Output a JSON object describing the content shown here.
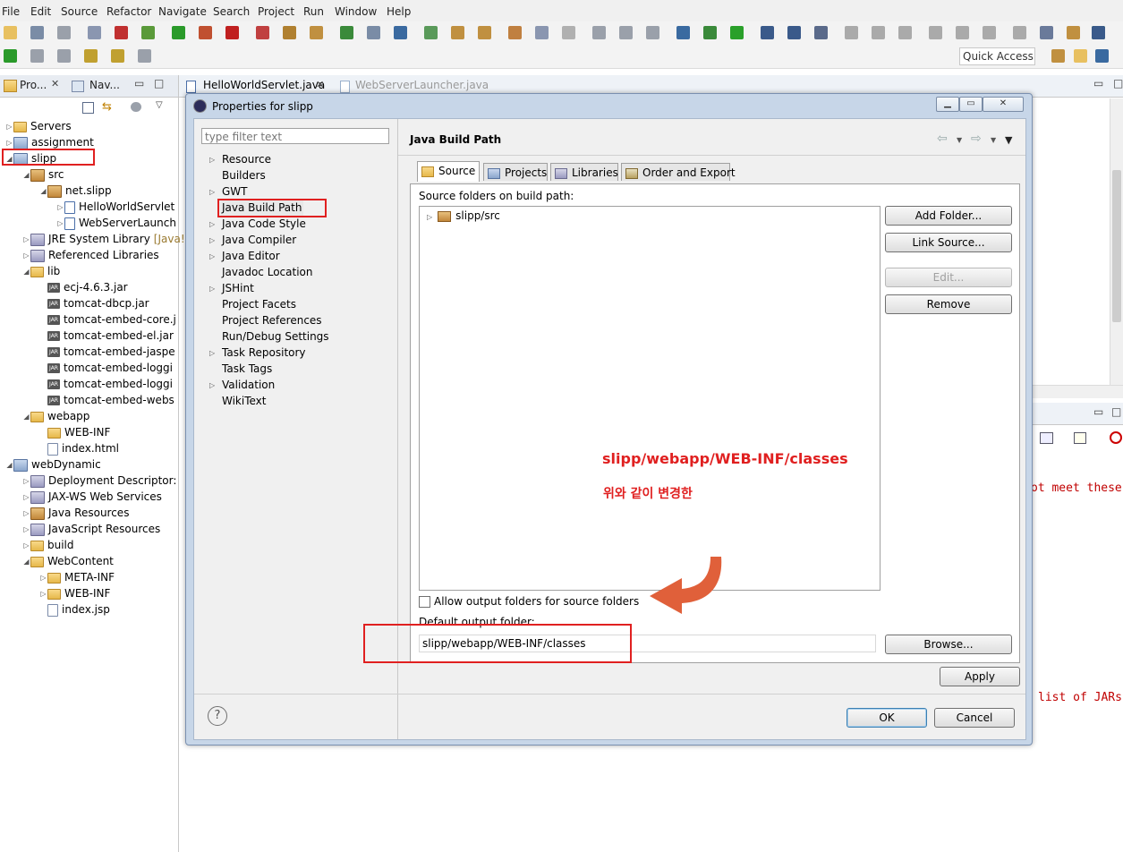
{
  "menu": [
    "File",
    "Edit",
    "Source",
    "Refactor",
    "Navigate",
    "Search",
    "Project",
    "Run",
    "Window",
    "Help"
  ],
  "quick_access": "Quick Access",
  "left_panel": {
    "tabs": [
      "Pro...",
      "Nav..."
    ],
    "tree": [
      {
        "label": "Servers",
        "depth": 0,
        "icon": "folder-icon",
        "twisty": "▷"
      },
      {
        "label": "assignment",
        "depth": 0,
        "icon": "project-icon",
        "twisty": "▷"
      },
      {
        "label": "slipp",
        "depth": 0,
        "icon": "project-icon",
        "twisty": "◢"
      },
      {
        "label": "src",
        "depth": 1,
        "icon": "package-folder-icon",
        "twisty": "◢"
      },
      {
        "label": "net.slipp",
        "depth": 2,
        "icon": "package-icon",
        "twisty": "◢"
      },
      {
        "label": "HelloWorldServlet",
        "depth": 3,
        "icon": "java-file-icon",
        "twisty": "▷"
      },
      {
        "label": "WebServerLaunch",
        "depth": 3,
        "icon": "java-file-icon",
        "twisty": "▷"
      },
      {
        "label": "JRE System Library",
        "suffix": "[Java!",
        "depth": 1,
        "icon": "library-icon",
        "twisty": "▷"
      },
      {
        "label": "Referenced Libraries",
        "depth": 1,
        "icon": "library-icon",
        "twisty": "▷"
      },
      {
        "label": "lib",
        "depth": 1,
        "icon": "folder-icon",
        "twisty": "◢"
      },
      {
        "label": "ecj-4.6.3.jar",
        "depth": 2,
        "icon": "jar-icon",
        "twisty": ""
      },
      {
        "label": "tomcat-dbcp.jar",
        "depth": 2,
        "icon": "jar-icon",
        "twisty": ""
      },
      {
        "label": "tomcat-embed-core.j",
        "depth": 2,
        "icon": "jar-icon",
        "twisty": ""
      },
      {
        "label": "tomcat-embed-el.jar",
        "depth": 2,
        "icon": "jar-icon",
        "twisty": ""
      },
      {
        "label": "tomcat-embed-jaspe",
        "depth": 2,
        "icon": "jar-icon",
        "twisty": ""
      },
      {
        "label": "tomcat-embed-loggi",
        "depth": 2,
        "icon": "jar-icon",
        "twisty": ""
      },
      {
        "label": "tomcat-embed-loggi",
        "depth": 2,
        "icon": "jar-icon",
        "twisty": ""
      },
      {
        "label": "tomcat-embed-webs",
        "depth": 2,
        "icon": "jar-icon",
        "twisty": ""
      },
      {
        "label": "webapp",
        "depth": 1,
        "icon": "folder-icon",
        "twisty": "◢"
      },
      {
        "label": "WEB-INF",
        "depth": 2,
        "icon": "folder-icon",
        "twisty": ""
      },
      {
        "label": "index.html",
        "depth": 2,
        "icon": "file-icon",
        "twisty": ""
      },
      {
        "label": "webDynamic",
        "depth": 0,
        "icon": "project-icon",
        "twisty": "◢"
      },
      {
        "label": "Deployment Descriptor:",
        "depth": 1,
        "icon": "descriptor-icon",
        "twisty": "▷"
      },
      {
        "label": "JAX-WS Web Services",
        "depth": 1,
        "icon": "webservice-icon",
        "twisty": "▷"
      },
      {
        "label": "Java Resources",
        "depth": 1,
        "icon": "package-folder-icon",
        "twisty": "▷"
      },
      {
        "label": "JavaScript Resources",
        "depth": 1,
        "icon": "library-icon",
        "twisty": "▷"
      },
      {
        "label": "build",
        "depth": 1,
        "icon": "folder-icon",
        "twisty": "▷"
      },
      {
        "label": "WebContent",
        "depth": 1,
        "icon": "folder-icon",
        "twisty": "◢"
      },
      {
        "label": "META-INF",
        "depth": 2,
        "icon": "folder-icon",
        "twisty": "▷"
      },
      {
        "label": "WEB-INF",
        "depth": 2,
        "icon": "folder-icon",
        "twisty": "▷"
      },
      {
        "label": "index.jsp",
        "depth": 2,
        "icon": "file-icon",
        "twisty": ""
      }
    ]
  },
  "editor_tabs": [
    {
      "label": "HelloWorldServlet.java",
      "active": true,
      "close": "✕"
    },
    {
      "label": "WebServerLauncher.java",
      "active": false
    }
  ],
  "background_console": {
    "line1": "ot meet these",
    "line2": "list of JARs"
  },
  "dialog": {
    "title": "Properties for slipp",
    "filter_placeholder": "type filter text",
    "nav": [
      {
        "label": "Resource",
        "arrow": true
      },
      {
        "label": "Builders",
        "arrow": false
      },
      {
        "label": "GWT",
        "arrow": true
      },
      {
        "label": "Java Build Path",
        "arrow": false,
        "selected": true
      },
      {
        "label": "Java Code Style",
        "arrow": true
      },
      {
        "label": "Java Compiler",
        "arrow": true
      },
      {
        "label": "Java Editor",
        "arrow": true
      },
      {
        "label": "Javadoc Location",
        "arrow": false
      },
      {
        "label": "JSHint",
        "arrow": true
      },
      {
        "label": "Project Facets",
        "arrow": false
      },
      {
        "label": "Project References",
        "arrow": false
      },
      {
        "label": "Run/Debug Settings",
        "arrow": false
      },
      {
        "label": "Task Repository",
        "arrow": true
      },
      {
        "label": "Task Tags",
        "arrow": false
      },
      {
        "label": "Validation",
        "arrow": true
      },
      {
        "label": "WikiText",
        "arrow": false
      }
    ],
    "page_title": "Java Build Path",
    "tabs": [
      "Source",
      "Projects",
      "Libraries",
      "Order and Export"
    ],
    "source_folders_label": "Source folders on build path:",
    "source_folders": [
      "slipp/src"
    ],
    "buttons": {
      "add_folder": "Add Folder...",
      "link_source": "Link Source...",
      "edit": "Edit...",
      "remove": "Remove",
      "browse": "Browse...",
      "apply": "Apply",
      "ok": "OK",
      "cancel": "Cancel"
    },
    "allow_output_label": "Allow output folders for source folders",
    "allow_output_checked": false,
    "default_output_label": "Default output folder:",
    "default_output_value": "slipp/webapp/WEB-INF/classes",
    "help_glyph": "?"
  },
  "annotation": {
    "line1": "slipp/webapp/WEB-INF/classes",
    "line2": "위와 같이 변경한",
    "color": "#e02020"
  },
  "colors": {
    "accent_arrow": "#e0603a",
    "annotation_box": "#e02020"
  }
}
